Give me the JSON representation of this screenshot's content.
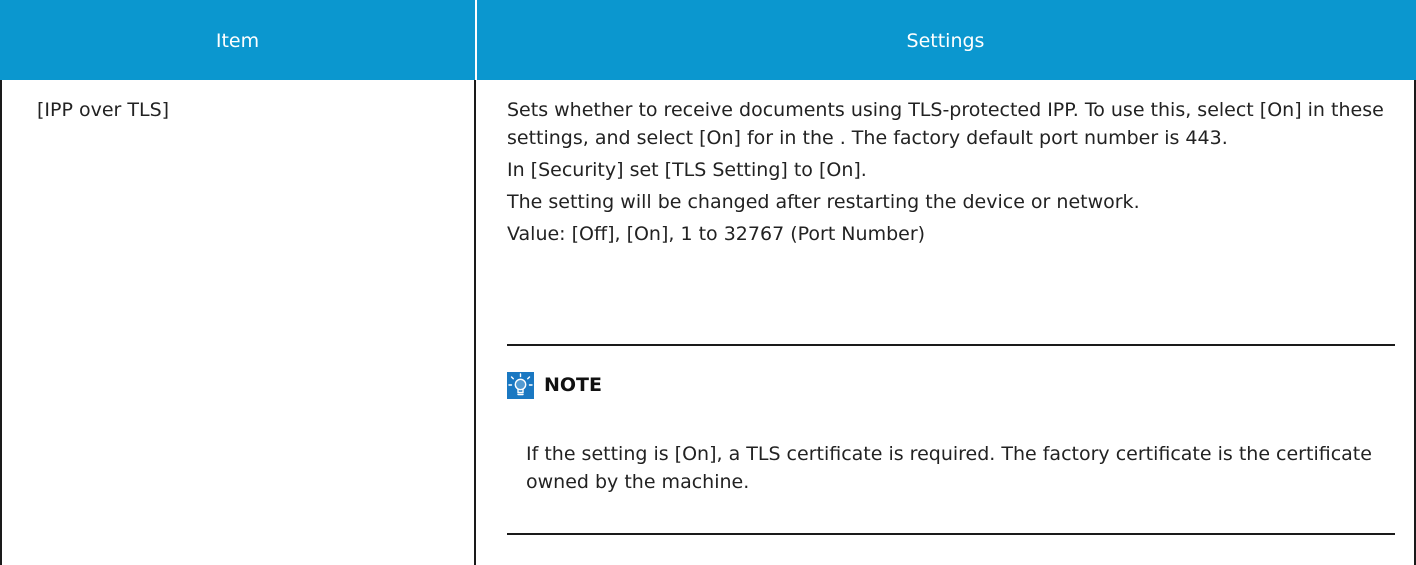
{
  "table": {
    "headers": {
      "item": "Item",
      "settings": "Settings"
    },
    "row": {
      "item": "[IPP over TLS]",
      "paragraphs": [
        "Sets whether to receive documents using TLS-protected IPP. To use this, select [On] in these settings, and select [On] for in the . The factory default port number is 443.",
        "In [Security] set [TLS Setting] to [On].",
        "The setting will be changed after restarting the device or network.",
        "Value: [Off], [On], 1 to 32767 (Port Number)"
      ],
      "note": {
        "icon": "lightbulb-icon",
        "title": "NOTE",
        "text": "If the setting is [On], a TLS certificate is required. The factory certificate is the certificate owned by the machine."
      }
    }
  },
  "colors": {
    "header_bg": "#0b97cf",
    "note_icon_bg": "#1a78c2"
  }
}
